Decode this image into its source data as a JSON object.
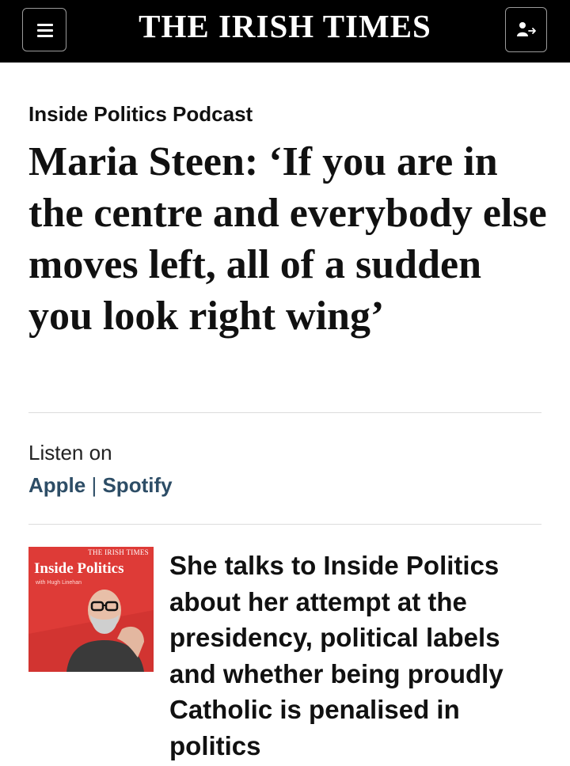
{
  "header": {
    "logo_text": "THE IRISH TIMES",
    "menu_icon": "hamburger-menu-icon",
    "account_icon": "account-sign-in-icon"
  },
  "article": {
    "section": "Inside Politics Podcast",
    "headline": "Maria Steen: ‘If you are in the centre and everybody else moves left, all of a sudden you look right wing’",
    "standfirst": "She talks to Inside Politics about her attempt at the presidency, political labels and whether being proudly Catholic is penalised in politics"
  },
  "listen": {
    "label": "Listen on",
    "apple": "Apple",
    "separator": "|",
    "spotify": "Spotify"
  },
  "podcast_art": {
    "brand": "THE IRISH TIMES",
    "title": "Inside Politics",
    "subtitle": "with Hugh Linehan"
  },
  "colors": {
    "header_bg": "#000000",
    "link": "#2d4d66",
    "podcast_red": "#de3b37"
  }
}
